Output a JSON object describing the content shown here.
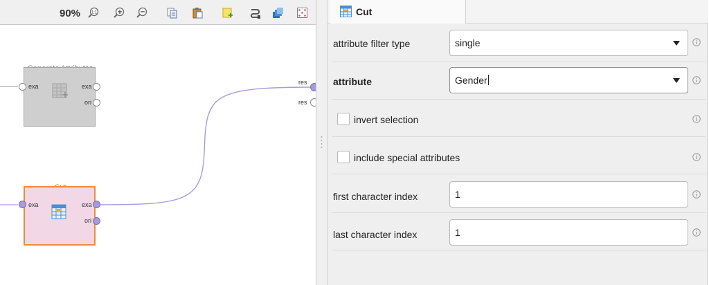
{
  "canvas": {
    "zoom": "90%",
    "operators": {
      "generate_attributes": {
        "label": "Generate Attributes",
        "in_port": "exa",
        "out_ports": [
          "exa",
          "ori"
        ]
      },
      "cut": {
        "label": "Cut",
        "in_port": "exa",
        "out_ports": [
          "exa",
          "ori"
        ]
      }
    },
    "result_ports": [
      "res",
      "res"
    ]
  },
  "parameters": {
    "title": "Cut",
    "rows": {
      "attribute_filter_type": {
        "label": "attribute filter type",
        "value": "single"
      },
      "attribute": {
        "label": "attribute",
        "value": "Gender"
      },
      "invert_selection": {
        "label": "invert selection",
        "checked": false
      },
      "include_special_attributes": {
        "label": "include special attributes",
        "checked": false
      },
      "first_character_index": {
        "label": "first character index",
        "value": "1"
      },
      "last_character_index": {
        "label": "last character index",
        "value": "1"
      }
    }
  },
  "colors": {
    "operator_gray": "#cfcfcf",
    "cut_fill": "#f2d7e6",
    "cut_border": "#f08a3c",
    "cut_label": "#e87722",
    "connected_port": "#a99ad9",
    "wire": "#a99ad9"
  },
  "icons": [
    "zoom-reset-icon",
    "zoom-in-icon",
    "zoom-out-icon",
    "copy-icon",
    "paste-icon",
    "add-note-icon",
    "auto-wire-icon",
    "layers-icon",
    "arrange-icon",
    "info-icon",
    "table-icon"
  ]
}
